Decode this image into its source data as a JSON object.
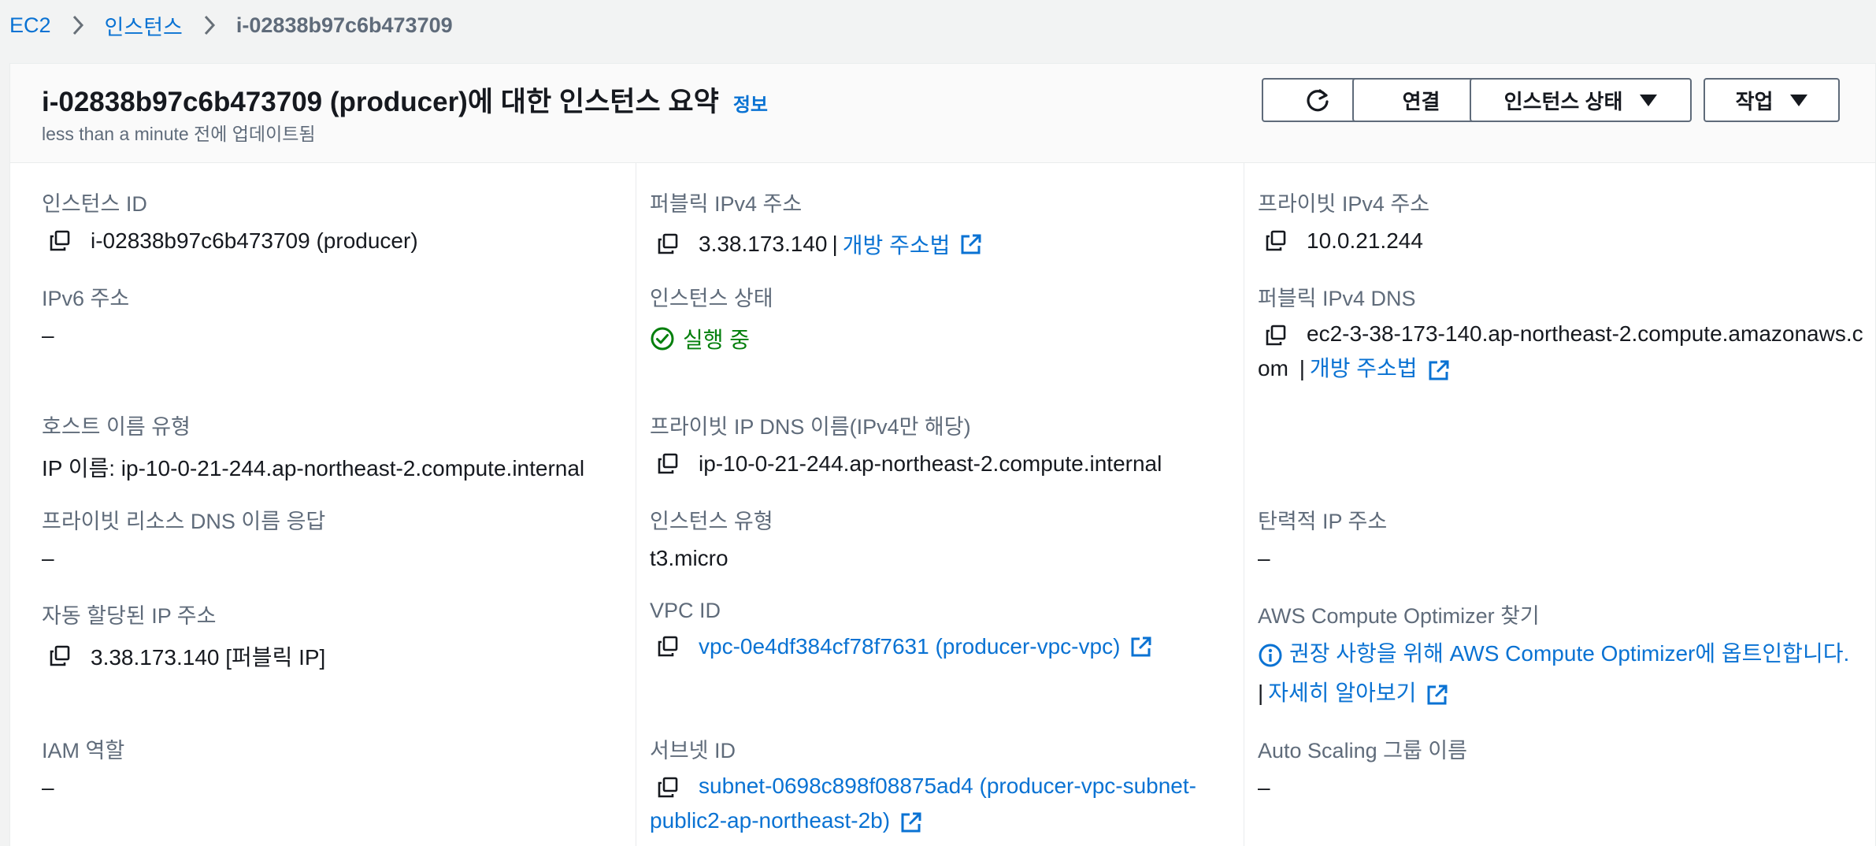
{
  "breadcrumb": {
    "ec2": "EC2",
    "instances": "인스턴스",
    "current": "i-02838b97c6b473709"
  },
  "header": {
    "title": "i-02838b97c6b473709 (producer)에 대한 인스턴스 요약",
    "info": "정보",
    "subtitle": "less than a minute 전에 업데이트됨",
    "connect": "연결",
    "instance_state": "인스턴스 상태",
    "actions": "작업"
  },
  "fields": {
    "instance_id": {
      "label": "인스턴스 ID",
      "value": "i-02838b97c6b473709 (producer)"
    },
    "public_ipv4": {
      "label": "퍼블릭 IPv4 주소",
      "value": "3.38.173.140",
      "sep": "|",
      "link": "개방 주소법"
    },
    "private_ipv4": {
      "label": "프라이빗 IPv4 주소",
      "value": "10.0.21.244"
    },
    "ipv6": {
      "label": "IPv6 주소",
      "value": "–"
    },
    "instance_state": {
      "label": "인스턴스 상태",
      "value": "실행 중"
    },
    "public_dns": {
      "label": "퍼블릭 IPv4 DNS",
      "value": "ec2-3-38-173-140.ap-northeast-2.compute.amazonaws.com",
      "sep": "|",
      "link": "개방 주소법"
    },
    "hostname_type": {
      "label": "호스트 이름 유형",
      "value": "IP 이름: ip-10-0-21-244.ap-northeast-2.compute.internal"
    },
    "private_dns": {
      "label": "프라이빗 IP DNS 이름(IPv4만 해당)",
      "value": "ip-10-0-21-244.ap-northeast-2.compute.internal"
    },
    "private_resource_dns": {
      "label": "프라이빗 리소스 DNS 이름 응답",
      "value": "–"
    },
    "instance_type": {
      "label": "인스턴스 유형",
      "value": "t3.micro"
    },
    "elastic_ip": {
      "label": "탄력적 IP 주소",
      "value": "–"
    },
    "auto_ip": {
      "label": "자동 할당된 IP 주소",
      "value": "3.38.173.140 [퍼블릭 IP]"
    },
    "vpc_id": {
      "label": "VPC ID",
      "value": "vpc-0e4df384cf78f7631 (producer-vpc-vpc)"
    },
    "compute_optimizer": {
      "label": "AWS Compute Optimizer 찾기",
      "value": "권장 사항을 위해 AWS Compute Optimizer에 옵트인합니다.",
      "sep": "|",
      "link": "자세히 알아보기"
    },
    "iam_role": {
      "label": "IAM 역할",
      "value": "–"
    },
    "subnet_id": {
      "label": "서브넷 ID",
      "value": "subnet-0698c898f08875ad4 (producer-vpc-subnet-public2-ap-northeast-2b)"
    },
    "asg_name": {
      "label": "Auto Scaling 그룹 이름",
      "value": "–"
    }
  },
  "colors": {
    "link": "#0972d3",
    "success": "#037f0c",
    "label": "#5f6b7a"
  }
}
